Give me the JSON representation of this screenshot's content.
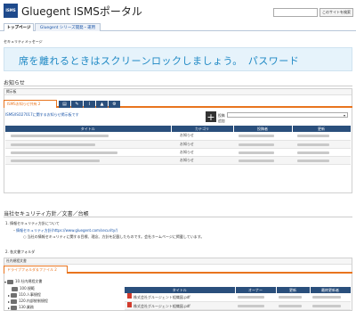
{
  "header": {
    "logo_text": "ISMS",
    "title": "Gluegent ISMSポータル",
    "search_placeholder": "",
    "search_button": "このサイトを検索"
  },
  "nav": {
    "tabs": [
      {
        "label": "トップページ"
      },
      {
        "label": "Gluegent シリーズ開発・運用"
      }
    ]
  },
  "security_message": {
    "label": "セキュリティメッセージ",
    "ticker": "席を離れるときはスクリーンロックしましょう。　パスワード"
  },
  "notices": {
    "heading": "お知らせ",
    "box_label": "掲示板",
    "active_tab": "ISMSお知らせ共有 2",
    "tab_icons": [
      "doc-icon",
      "pencil-icon",
      "clip-icon",
      "alert-icon",
      "gear-icon"
    ],
    "link": "ISMS/ISO27017に関するお知らせ掲示板です",
    "add_label": "投稿",
    "add_sub": "追加",
    "columns": [
      "タイトル",
      "カテゴリ",
      "投稿者",
      "更新"
    ],
    "rows": [
      {
        "category": "お知らせ"
      },
      {
        "category": "お知らせ"
      },
      {
        "category": "お知らせ"
      },
      {
        "category": "お知らせ"
      }
    ]
  },
  "policy": {
    "heading": "当社セキュリティ方針／文書／台帳",
    "item1_title": "1. 情報セキュリティ方針について",
    "item1_link": "情報セキュリティ方針(https://www.gluegent.com/security/)",
    "item1_desc": "当社の情報セキュリティに関する目標、理念、方針を記載したものです。会社ホームページに掲載しています。",
    "item2_title": "2. 各文書フォルダ",
    "box_label": "社内規程文書",
    "drive_tab": "ドライブフォルダ＆ファイル 2",
    "tree_header": "",
    "tree": [
      {
        "label": "10.社内規程文書"
      },
      {
        "label": "100.規範"
      },
      {
        "label": "110.人事規程"
      },
      {
        "label": "120.内部統制規程"
      },
      {
        "label": "130.業務"
      }
    ],
    "table_columns": [
      "タイトル",
      "オーナー",
      "更新",
      "最終更新者"
    ],
    "files": [
      {
        "name": "株式会社グルージェント組織図.pdf"
      },
      {
        "name": "株式会社グルージェント組織図.pdf"
      }
    ]
  }
}
